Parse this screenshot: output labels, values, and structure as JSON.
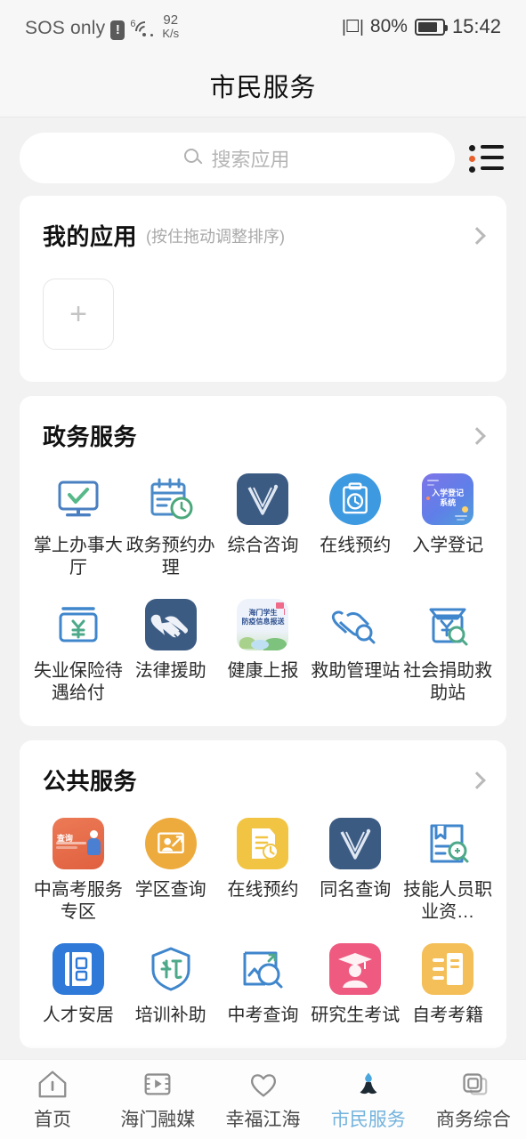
{
  "status_bar": {
    "carrier": "SOS only",
    "warning_glyph": "!",
    "wifi_superscript": "6",
    "net_speed_value": "92",
    "net_speed_unit": "K/s",
    "battery_percent": "80%",
    "time": "15:42"
  },
  "header": {
    "title": "市民服务"
  },
  "search": {
    "placeholder": "搜索应用",
    "icon": "search-icon",
    "list_icon": "list-view-icon"
  },
  "my_apps": {
    "title": "我的应用",
    "subtitle": "(按住拖动调整排序)",
    "add_label": "+",
    "arrow": "chevron-right-icon"
  },
  "sections": [
    {
      "title": "政务服务",
      "apps": [
        {
          "label": "掌上办事大厅",
          "icon": "monitor-check-icon",
          "color": "#4a7fc1"
        },
        {
          "label": "政务预约办理",
          "icon": "calendar-clock-icon",
          "color": "#4a8ac9"
        },
        {
          "label": "综合咨询",
          "icon": "v-logo-icon",
          "color": "#3c5b83"
        },
        {
          "label": "在线预约",
          "icon": "clipboard-clock-icon",
          "color": "#3d9ae0"
        },
        {
          "label": "入学登记",
          "icon": "enrollment-registration-tile",
          "color": "#6b63d8",
          "tile_text": "入学登记\n系统"
        },
        {
          "label": "失业保险待遇给付",
          "icon": "yuan-box-icon",
          "color": "#3f86cc"
        },
        {
          "label": "法律援助",
          "icon": "handshake-heart-icon",
          "color": "#3c5b83"
        },
        {
          "label": "健康上报",
          "icon": "health-report-tile",
          "color": "#e8eef8",
          "tile_text": "海门学生\n防疫信息报送"
        },
        {
          "label": "救助管理站",
          "icon": "handshake-search-icon",
          "color": "#3f86cc"
        },
        {
          "label": "社会捐助救助站",
          "icon": "envelope-yuan-search-icon",
          "color": "#3f86cc"
        }
      ]
    },
    {
      "title": "公共服务",
      "apps": [
        {
          "label": "中高考服务专区",
          "icon": "exam-service-tile",
          "color": "#e8714a",
          "tile_text": "查询"
        },
        {
          "label": "学区查询",
          "icon": "school-district-icon",
          "color": "#eeab3d"
        },
        {
          "label": "在线预约",
          "icon": "document-clock-icon",
          "color": "#f1c543"
        },
        {
          "label": "同名查询",
          "icon": "v-logo-icon",
          "color": "#3c5b83"
        },
        {
          "label": "技能人员职业资…",
          "icon": "certificate-search-icon",
          "color": "#3f86cc"
        },
        {
          "label": "人才安居",
          "icon": "household-book-icon",
          "color": "#2f79d8"
        },
        {
          "label": "培训补助",
          "icon": "subsidy-shield-icon",
          "color": "#3f86cc"
        },
        {
          "label": "中考查询",
          "icon": "image-search-icon",
          "color": "#3f86cc"
        },
        {
          "label": "研究生考试",
          "icon": "graduate-icon",
          "color": "#ef5a80"
        },
        {
          "label": "自考考籍",
          "icon": "id-card-icon",
          "color": "#f4be58"
        }
      ]
    }
  ],
  "tabbar": {
    "items": [
      {
        "label": "首页",
        "icon": "home-icon",
        "active": false
      },
      {
        "label": "海门融媒",
        "icon": "video-icon",
        "active": false
      },
      {
        "label": "幸福江海",
        "icon": "heart-icon",
        "active": false
      },
      {
        "label": "市民服务",
        "icon": "citizen-service-icon",
        "active": true
      },
      {
        "label": "商务综合",
        "icon": "apps-icon",
        "active": false
      }
    ],
    "active_color": "#74b3dd"
  }
}
